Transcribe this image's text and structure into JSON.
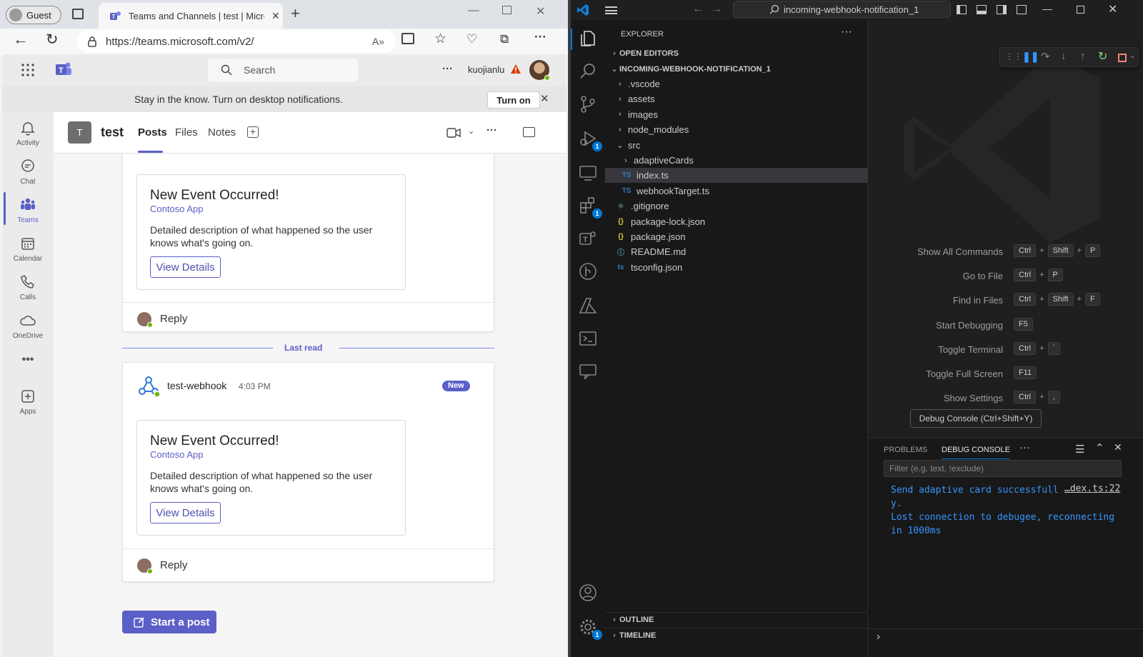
{
  "browser": {
    "guest_label": "Guest",
    "tab_title": "Teams and Channels | test | Micro",
    "url": "https://teams.microsoft.com/v2/"
  },
  "teams": {
    "search_placeholder": "Search",
    "username": "kuojianlu",
    "notification_text": "Stay in the know. Turn on desktop notifications.",
    "turn_on_label": "Turn on",
    "rail": [
      {
        "label": "Activity",
        "icon": "bell-icon"
      },
      {
        "label": "Chat",
        "icon": "chat-icon"
      },
      {
        "label": "Teams",
        "icon": "teams-icon"
      },
      {
        "label": "Calendar",
        "icon": "calendar-icon"
      },
      {
        "label": "Calls",
        "icon": "phone-icon"
      },
      {
        "label": "OneDrive",
        "icon": "cloud-icon"
      },
      {
        "label": "Apps",
        "icon": "apps-icon"
      }
    ],
    "more_label": "•••",
    "channel": {
      "avatar_letter": "T",
      "name": "test",
      "tabs": [
        "Posts",
        "Files",
        "Notes"
      ],
      "active_tab": "Posts"
    },
    "posts": [
      {
        "card_title": "New Event Occurred!",
        "card_subtitle": "Contoso App",
        "card_description": "Detailed description of what happened so the user knows what's going on.",
        "card_button": "View Details",
        "reply_label": "Reply"
      },
      {
        "author": "test-webhook",
        "time": "4:03 PM",
        "badge": "New",
        "card_title": "New Event Occurred!",
        "card_subtitle": "Contoso App",
        "card_description": "Detailed description of what happened so the user knows what's going on.",
        "card_button": "View Details",
        "reply_label": "Reply"
      }
    ],
    "last_read_label": "Last read",
    "start_post_label": "Start a post",
    "accent_color": "#5b5fc7"
  },
  "vscode": {
    "command_center": "incoming-webhook-notification_1",
    "explorer_title": "EXPLORER",
    "open_editors": "OPEN EDITORS",
    "project": "INCOMING-WEBHOOK-NOTIFICATION_1",
    "tree": [
      {
        "name": ".vscode",
        "kind": "folder",
        "depth": 1,
        "type": ""
      },
      {
        "name": "assets",
        "kind": "folder",
        "depth": 1,
        "type": ""
      },
      {
        "name": "images",
        "kind": "folder",
        "depth": 1,
        "type": ""
      },
      {
        "name": "node_modules",
        "kind": "folder",
        "depth": 1,
        "type": ""
      },
      {
        "name": "src",
        "kind": "folder-open",
        "depth": 1,
        "type": ""
      },
      {
        "name": "adaptiveCards",
        "kind": "folder",
        "depth": 2,
        "type": ""
      },
      {
        "name": "index.ts",
        "kind": "file",
        "depth": 2,
        "type": "TS",
        "selected": true
      },
      {
        "name": "webhookTarget.ts",
        "kind": "file",
        "depth": 2,
        "type": "TS"
      },
      {
        "name": ".gitignore",
        "kind": "file",
        "depth": 1,
        "type": "◆"
      },
      {
        "name": "package-lock.json",
        "kind": "file",
        "depth": 1,
        "type": "{}"
      },
      {
        "name": "package.json",
        "kind": "file",
        "depth": 1,
        "type": "{}"
      },
      {
        "name": "README.md",
        "kind": "file",
        "depth": 1,
        "type": "ⓘ"
      },
      {
        "name": "tsconfig.json",
        "kind": "file",
        "depth": 1,
        "type": "ts"
      }
    ],
    "shortcuts": [
      {
        "label": "Show All Commands",
        "keys": [
          "Ctrl",
          "Shift",
          "P"
        ]
      },
      {
        "label": "Go to File",
        "keys": [
          "Ctrl",
          "P"
        ]
      },
      {
        "label": "Find in Files",
        "keys": [
          "Ctrl",
          "Shift",
          "F"
        ]
      },
      {
        "label": "Start Debugging",
        "keys": [
          "F5"
        ]
      },
      {
        "label": "Toggle Terminal",
        "keys": [
          "Ctrl",
          "`"
        ]
      },
      {
        "label": "Toggle Full Screen",
        "keys": [
          "F11"
        ]
      },
      {
        "label": "Show Settings",
        "keys": [
          "Ctrl",
          ","
        ]
      }
    ],
    "tooltip": "Debug Console (Ctrl+Shift+Y)",
    "panel": {
      "tab_problems": "PROBLEMS",
      "tab_debug": "DEBUG CONSOLE",
      "more": "···",
      "filter_placeholder": "Filter (e.g. text, !exclude)",
      "output": [
        "Send adaptive card successfull",
        "y.",
        "Lost connection to debugee, reconnecting",
        "in 1000ms"
      ],
      "source_link": "…dex.ts:22"
    },
    "outline_label": "OUTLINE",
    "timeline_label": "TIMELINE",
    "badges": {
      "run": "1",
      "extensions": "1",
      "settings": "1"
    }
  }
}
